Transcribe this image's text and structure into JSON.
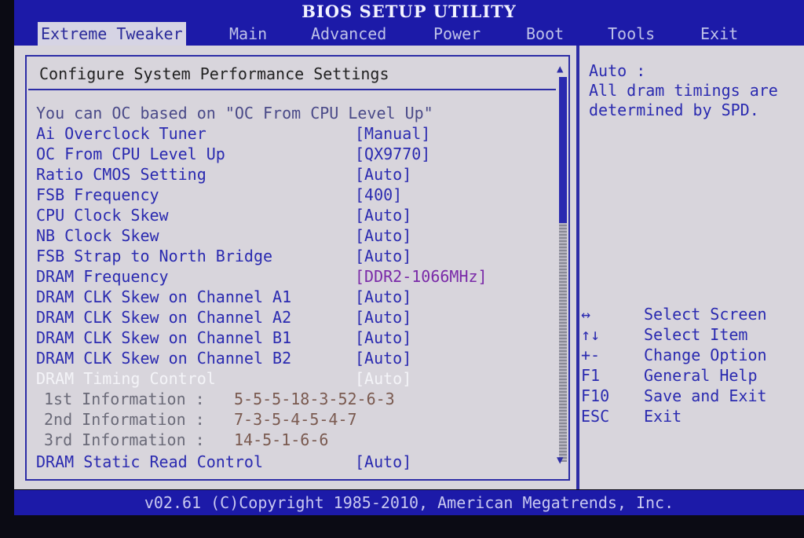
{
  "title": "BIOS SETUP UTILITY",
  "menu": [
    "Extreme Tweaker",
    "Main",
    "Advanced",
    "Power",
    "Boot",
    "Tools",
    "Exit"
  ],
  "section_title": "Configure System Performance Settings",
  "note": "You can OC based on \"OC From CPU Level Up\"",
  "settings": [
    {
      "label": "Ai Overclock Tuner",
      "value": "[Manual]"
    },
    {
      "label": "OC From CPU Level Up",
      "value": "[QX9770]"
    },
    {
      "label": "Ratio CMOS Setting",
      "value": "[Auto]"
    },
    {
      "label": "FSB Frequency",
      "value": "[400]"
    },
    {
      "label": "CPU Clock Skew",
      "value": "[Auto]"
    },
    {
      "label": "NB Clock Skew",
      "value": "[Auto]"
    },
    {
      "label": "FSB Strap to North Bridge",
      "value": "[Auto]"
    },
    {
      "label": "DRAM Frequency",
      "value": "[DDR2-1066MHz]"
    },
    {
      "label": "DRAM CLK Skew on Channel A1",
      "value": "[Auto]"
    },
    {
      "label": "DRAM CLK Skew on Channel A2",
      "value": "[Auto]"
    },
    {
      "label": "DRAM CLK Skew on Channel B1",
      "value": "[Auto]"
    },
    {
      "label": "DRAM CLK Skew on Channel B2",
      "value": "[Auto]"
    },
    {
      "label": "DRAM Timing Control",
      "value": "[Auto]"
    }
  ],
  "info": [
    {
      "label": "1st Information :",
      "value": "5-5-5-18-3-52-6-3"
    },
    {
      "label": "2nd Information :",
      "value": "7-3-5-4-5-4-7"
    },
    {
      "label": "3rd Information :",
      "value": "14-5-1-6-6"
    }
  ],
  "last_setting": {
    "label": "DRAM Static Read Control",
    "value": "[Auto]"
  },
  "help_text": "Auto :\nAll dram timings are\ndetermined by SPD.",
  "keys": [
    {
      "key": "↔",
      "action": "Select Screen"
    },
    {
      "key": "↑↓",
      "action": "Select Item"
    },
    {
      "key": "+-",
      "action": "Change Option"
    },
    {
      "key": "F1",
      "action": "General Help"
    },
    {
      "key": "F10",
      "action": "Save and Exit"
    },
    {
      "key": "ESC",
      "action": "Exit"
    }
  ],
  "footer": "v02.61 (C)Copyright 1985-2010, American Megatrends, Inc.",
  "scroll": {
    "up": "▲",
    "down": "▼"
  }
}
